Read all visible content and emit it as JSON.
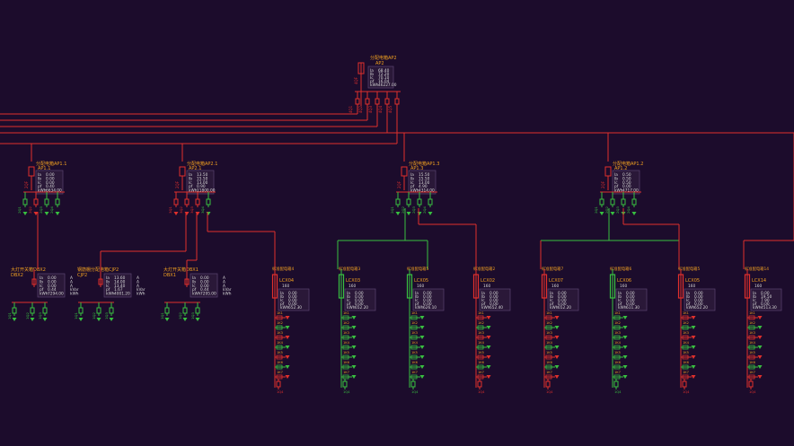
{
  "colors": {
    "background": "#1c0c2c",
    "energized": "#e0302c",
    "deenergized": "#38c040",
    "label": "#f0a020",
    "value": "#d8d8d8",
    "panel": "#2a1838"
  },
  "main_panel": {
    "name": "分配电箱AP2",
    "id": "AP2",
    "rows": [
      {
        "k": "Ia",
        "v": "68.40"
      },
      {
        "k": "Ib",
        "v": "72.20"
      },
      {
        "k": "Ic",
        "v": "70.10"
      },
      {
        "k": "pf",
        "v": "16.04"
      },
      {
        "k": "kWh",
        "v": "46227.00"
      }
    ],
    "breakers": [
      "4Q1",
      "4Q2",
      "4Q3",
      "4Q4",
      "4Q5"
    ]
  },
  "sub_panels": [
    {
      "name": "分配电箱AP1.1",
      "id": "AP1.1",
      "rows": [
        {
          "k": "Ia",
          "v": "0.00"
        },
        {
          "k": "Ib",
          "v": "0.00"
        },
        {
          "k": "Ic",
          "v": "0.00"
        },
        {
          "k": "pf",
          "v": "0.40"
        },
        {
          "k": "kWh",
          "v": "6634.00"
        }
      ],
      "breakers": [
        "2Q1",
        "2Q2",
        "2Q3",
        "2Q4"
      ]
    },
    {
      "name": "分配电箱AP2.1",
      "id": "AP2.1",
      "rows": [
        {
          "k": "Ia",
          "v": "13.50"
        },
        {
          "k": "Ib",
          "v": "15.50"
        },
        {
          "k": "Ic",
          "v": "13.00"
        },
        {
          "k": "pf",
          "v": "0.90"
        },
        {
          "k": "kWh",
          "v": "11800.00"
        }
      ],
      "breakers": [
        "3Q1",
        "3Q2",
        "3Q3",
        "3Q4"
      ]
    },
    {
      "name": "分配电箱AP1.3",
      "id": "AP1.3",
      "rows": [
        {
          "k": "Ia",
          "v": "15.50"
        },
        {
          "k": "Ib",
          "v": "15.50"
        },
        {
          "k": "Ic",
          "v": "13.00"
        },
        {
          "k": "pf",
          "v": "4.90"
        },
        {
          "k": "kWh",
          "v": "4314.00"
        }
      ],
      "breakers": [
        "2Q1",
        "2Q2",
        "2Q3",
        "2Q4"
      ]
    },
    {
      "name": "分配电箱AP1.2",
      "id": "AP1.2",
      "rows": [
        {
          "k": "Ia",
          "v": "0.50"
        },
        {
          "k": "Ib",
          "v": "0.50"
        },
        {
          "k": "Ic",
          "v": "0.50"
        },
        {
          "k": "pf",
          "v": "0.00"
        },
        {
          "k": "kWh",
          "v": "4717.00"
        }
      ],
      "breakers": [
        "2Q1",
        "2Q2",
        "2Q3",
        "2Q4"
      ]
    }
  ],
  "boxes": [
    {
      "name": "大灯开关箱DBX2",
      "id": "DBX2",
      "rows": [
        {
          "k": "Ia",
          "v": "0.00"
        },
        {
          "k": "Ib",
          "v": "0.00"
        },
        {
          "k": "Ic",
          "v": "0.00"
        },
        {
          "k": "pf",
          "v": "0.44"
        },
        {
          "k": "kWh",
          "v": "7294.00"
        }
      ],
      "units": [
        "A",
        "A",
        "A",
        "kVar",
        "kWh"
      ],
      "breakers": [
        "1Q1",
        "1Q2",
        "1Q3"
      ]
    },
    {
      "name": "钢筋棚分配电箱CJP2",
      "id": "CJP2",
      "rows": [
        {
          "k": "Ia",
          "v": "13.60"
        },
        {
          "k": "Ib",
          "v": "14.00"
        },
        {
          "k": "Ic",
          "v": "13.40"
        },
        {
          "k": "pf",
          "v": "1.67"
        },
        {
          "k": "kWh",
          "v": "4001.20"
        }
      ],
      "units": [
        "A",
        "A",
        "A",
        "kVar",
        "kWh"
      ],
      "breakers": [
        "1Q1",
        "1Q2",
        "1Q3"
      ]
    },
    {
      "name": "大灯开关箱DBX1",
      "id": "DBX1",
      "rows": [
        {
          "k": "Ia",
          "v": "0.00"
        },
        {
          "k": "Ib",
          "v": "0.00"
        },
        {
          "k": "Ic",
          "v": "0.00"
        },
        {
          "k": "pf",
          "v": "0.44"
        },
        {
          "k": "kWh",
          "v": "7295.00"
        }
      ],
      "units": [
        "A",
        "A",
        "A",
        "kVar",
        "kWh"
      ],
      "breakers": [
        "1Q1",
        "1Q2",
        "1Q3"
      ]
    }
  ],
  "cabinets": [
    {
      "name": "标准配电箱4",
      "id": "LCX04",
      "rating": "160",
      "energized": true,
      "rows": [
        {
          "k": "Ia",
          "v": "0.00"
        },
        {
          "k": "Ib",
          "v": "0.00"
        },
        {
          "k": "Ic",
          "v": "0.00"
        },
        {
          "k": "pf",
          "v": "0.00"
        },
        {
          "k": "kWh",
          "v": "652.30"
        }
      ],
      "outputs": [
        "1K1",
        "1K2",
        "1K3",
        "1K4",
        "1K5",
        "1K6",
        "1K7"
      ],
      "tail": "1Q4"
    },
    {
      "name": "标准配电箱3",
      "id": "LCX03",
      "rating": "160",
      "energized": false,
      "rows": [
        {
          "k": "Ia",
          "v": "0.00"
        },
        {
          "k": "Ib",
          "v": "0.00"
        },
        {
          "k": "Ic",
          "v": "0.00"
        },
        {
          "k": "pf",
          "v": "0.00"
        },
        {
          "k": "kWh",
          "v": "652.20"
        }
      ],
      "outputs": [
        "1K1",
        "1K2",
        "1K3",
        "1K4",
        "1K5",
        "1K6",
        "1K7"
      ],
      "tail": "1Q4"
    },
    {
      "name": "标准配电箱5",
      "id": "LCX05",
      "rating": "160",
      "energized": false,
      "rows": [
        {
          "k": "Ia",
          "v": "0.00"
        },
        {
          "k": "Ib",
          "v": "0.00"
        },
        {
          "k": "Ic",
          "v": "0.00"
        },
        {
          "k": "pf",
          "v": "0.00"
        },
        {
          "k": "kWh",
          "v": "626.10"
        }
      ],
      "outputs": [
        "1K1",
        "1K2",
        "1K3",
        "1K4",
        "1K5",
        "1K6",
        "1K7"
      ],
      "tail": "1Q4"
    },
    {
      "name": "标准配电箱2",
      "id": "LCX02",
      "rating": "160",
      "energized": true,
      "rows": [
        {
          "k": "Ia",
          "v": "0.00"
        },
        {
          "k": "Ib",
          "v": "0.00"
        },
        {
          "k": "Ic",
          "v": "0.00"
        },
        {
          "k": "pf",
          "v": "0.00"
        },
        {
          "k": "kWh",
          "v": "652.40"
        }
      ],
      "outputs": [
        "1K1",
        "1K2",
        "1K3",
        "1K4",
        "1K5",
        "1K6",
        "1K7"
      ],
      "tail": "1Q4"
    },
    {
      "name": "标准配电箱7",
      "id": "LCX07",
      "rating": "160",
      "energized": true,
      "rows": [
        {
          "k": "Ia",
          "v": "0.00"
        },
        {
          "k": "Ib",
          "v": "0.00"
        },
        {
          "k": "Ic",
          "v": "0.00"
        },
        {
          "k": "pf",
          "v": "0.00"
        },
        {
          "k": "kWh",
          "v": "652.20"
        }
      ],
      "outputs": [
        "1K1",
        "1K2",
        "1K3",
        "1K4",
        "1K5",
        "1K6",
        "1K7"
      ],
      "tail": "1Q4"
    },
    {
      "name": "标准配电箱6",
      "id": "LCX06",
      "rating": "160",
      "energized": false,
      "rows": [
        {
          "k": "Ia",
          "v": "0.00"
        },
        {
          "k": "Ib",
          "v": "0.00"
        },
        {
          "k": "Ic",
          "v": "0.00"
        },
        {
          "k": "pf",
          "v": "0.00"
        },
        {
          "k": "kWh",
          "v": "611.30"
        }
      ],
      "outputs": [
        "1K1",
        "1K2",
        "1K3",
        "1K4",
        "1K5",
        "1K6",
        "1K7"
      ],
      "tail": "1Q4"
    },
    {
      "name": "标准配电箱5",
      "id": "LCX05",
      "rating": "160",
      "energized": true,
      "rows": [
        {
          "k": "Ia",
          "v": "0.00"
        },
        {
          "k": "Ib",
          "v": "0.00"
        },
        {
          "k": "Ic",
          "v": "0.00"
        },
        {
          "k": "pf",
          "v": "0.00"
        },
        {
          "k": "kWh",
          "v": "652.20"
        }
      ],
      "outputs": [
        "1K1",
        "1K2",
        "1K3",
        "1K4",
        "1K5",
        "1K6",
        "1K7"
      ],
      "tail": "1Q4"
    },
    {
      "name": "标准配电箱14",
      "id": "LCX14",
      "rating": "160",
      "energized": true,
      "rows": [
        {
          "k": "Ia",
          "v": "0.00"
        },
        {
          "k": "Ib",
          "v": "19.50"
        },
        {
          "k": "Ic",
          "v": "7.90"
        },
        {
          "k": "pf",
          "v": "0.00"
        },
        {
          "k": "kWh",
          "v": "4513.30"
        }
      ],
      "outputs": [
        "1K1",
        "1K2",
        "1K3",
        "1K4",
        "1K5",
        "1K6",
        "1K7"
      ],
      "tail": "1Q4"
    }
  ]
}
